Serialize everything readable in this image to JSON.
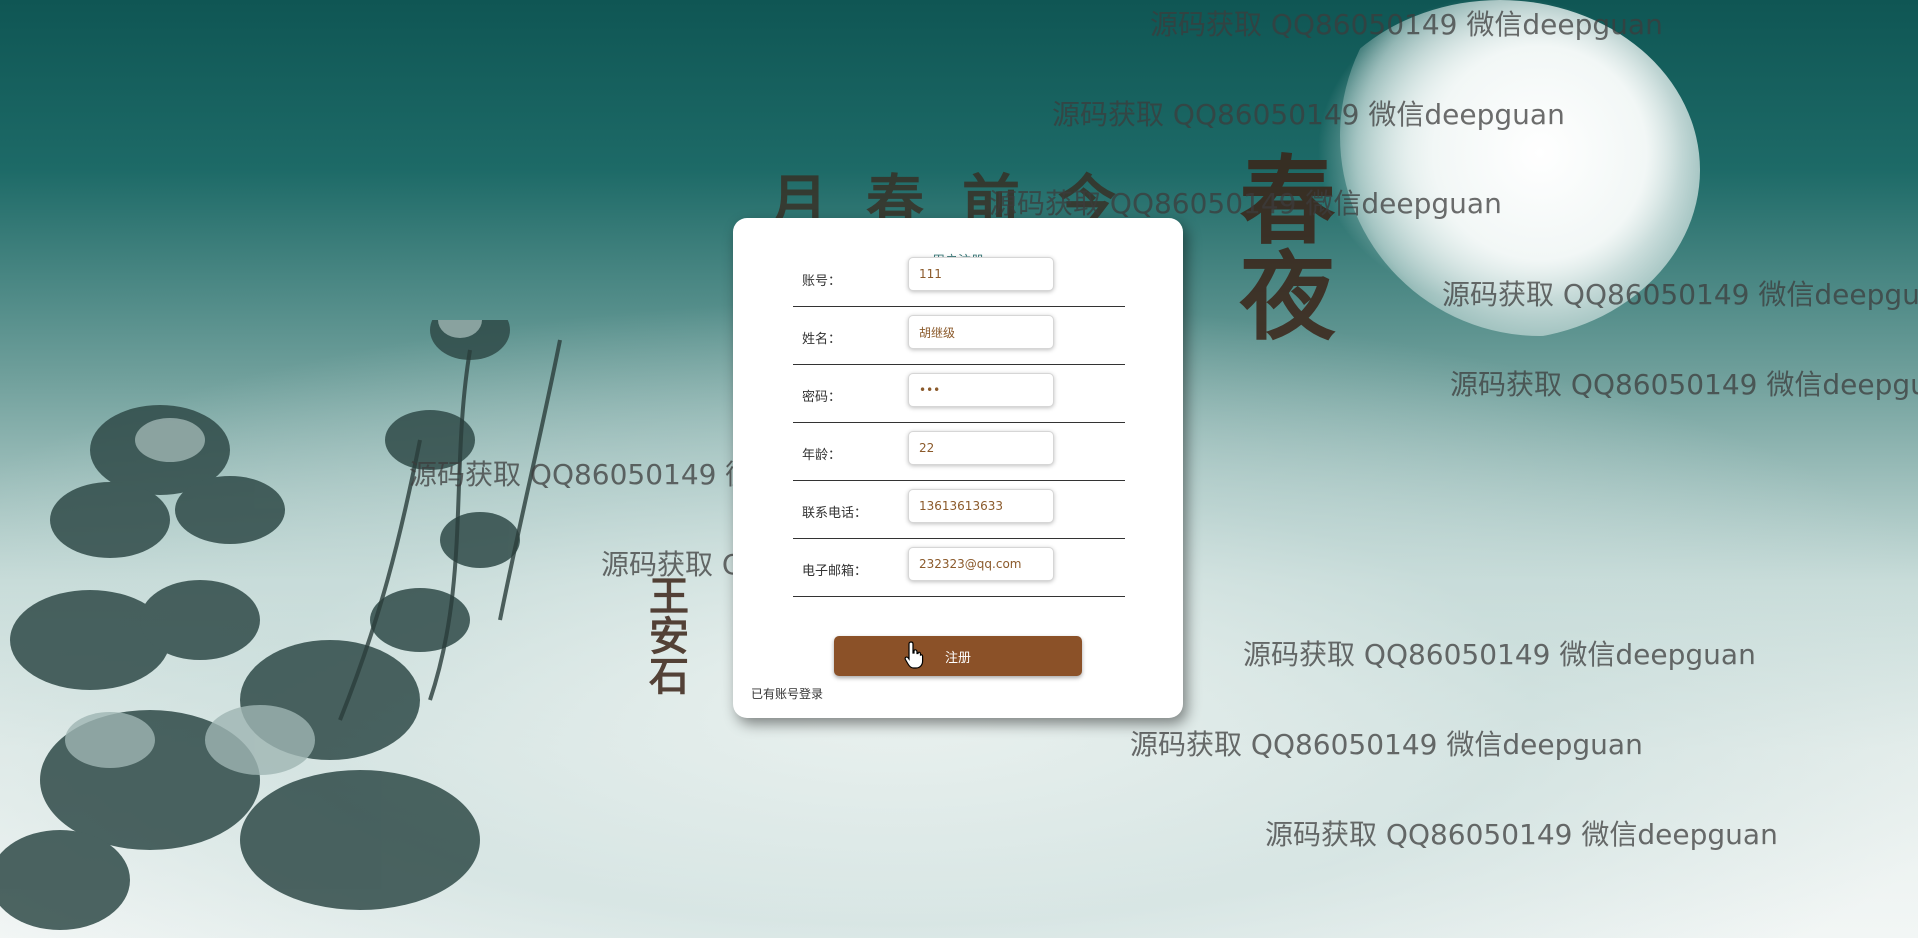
{
  "background": {
    "poem_title": "春夜",
    "poem_line": "月春前今",
    "author": "王安石",
    "watermark_text": "源码获取 QQ86050149 微信deepguan"
  },
  "form": {
    "title": "用户注册",
    "fields": [
      {
        "label": "账号：",
        "value": "111",
        "type": "text"
      },
      {
        "label": "姓名：",
        "value": "胡继级",
        "type": "text"
      },
      {
        "label": "密码：",
        "value": "111",
        "type": "password"
      },
      {
        "label": "年龄：",
        "value": "22",
        "type": "text"
      },
      {
        "label": "联系电话：",
        "value": "13613613633",
        "type": "text"
      },
      {
        "label": "电子邮箱：",
        "value": "232323@qq.com",
        "type": "text"
      }
    ],
    "submit_label": "注册",
    "login_link": "已有账号登录"
  },
  "colors": {
    "button": "#8b5128",
    "title": "#3b7a7a",
    "input_text": "#8b5a2b"
  }
}
